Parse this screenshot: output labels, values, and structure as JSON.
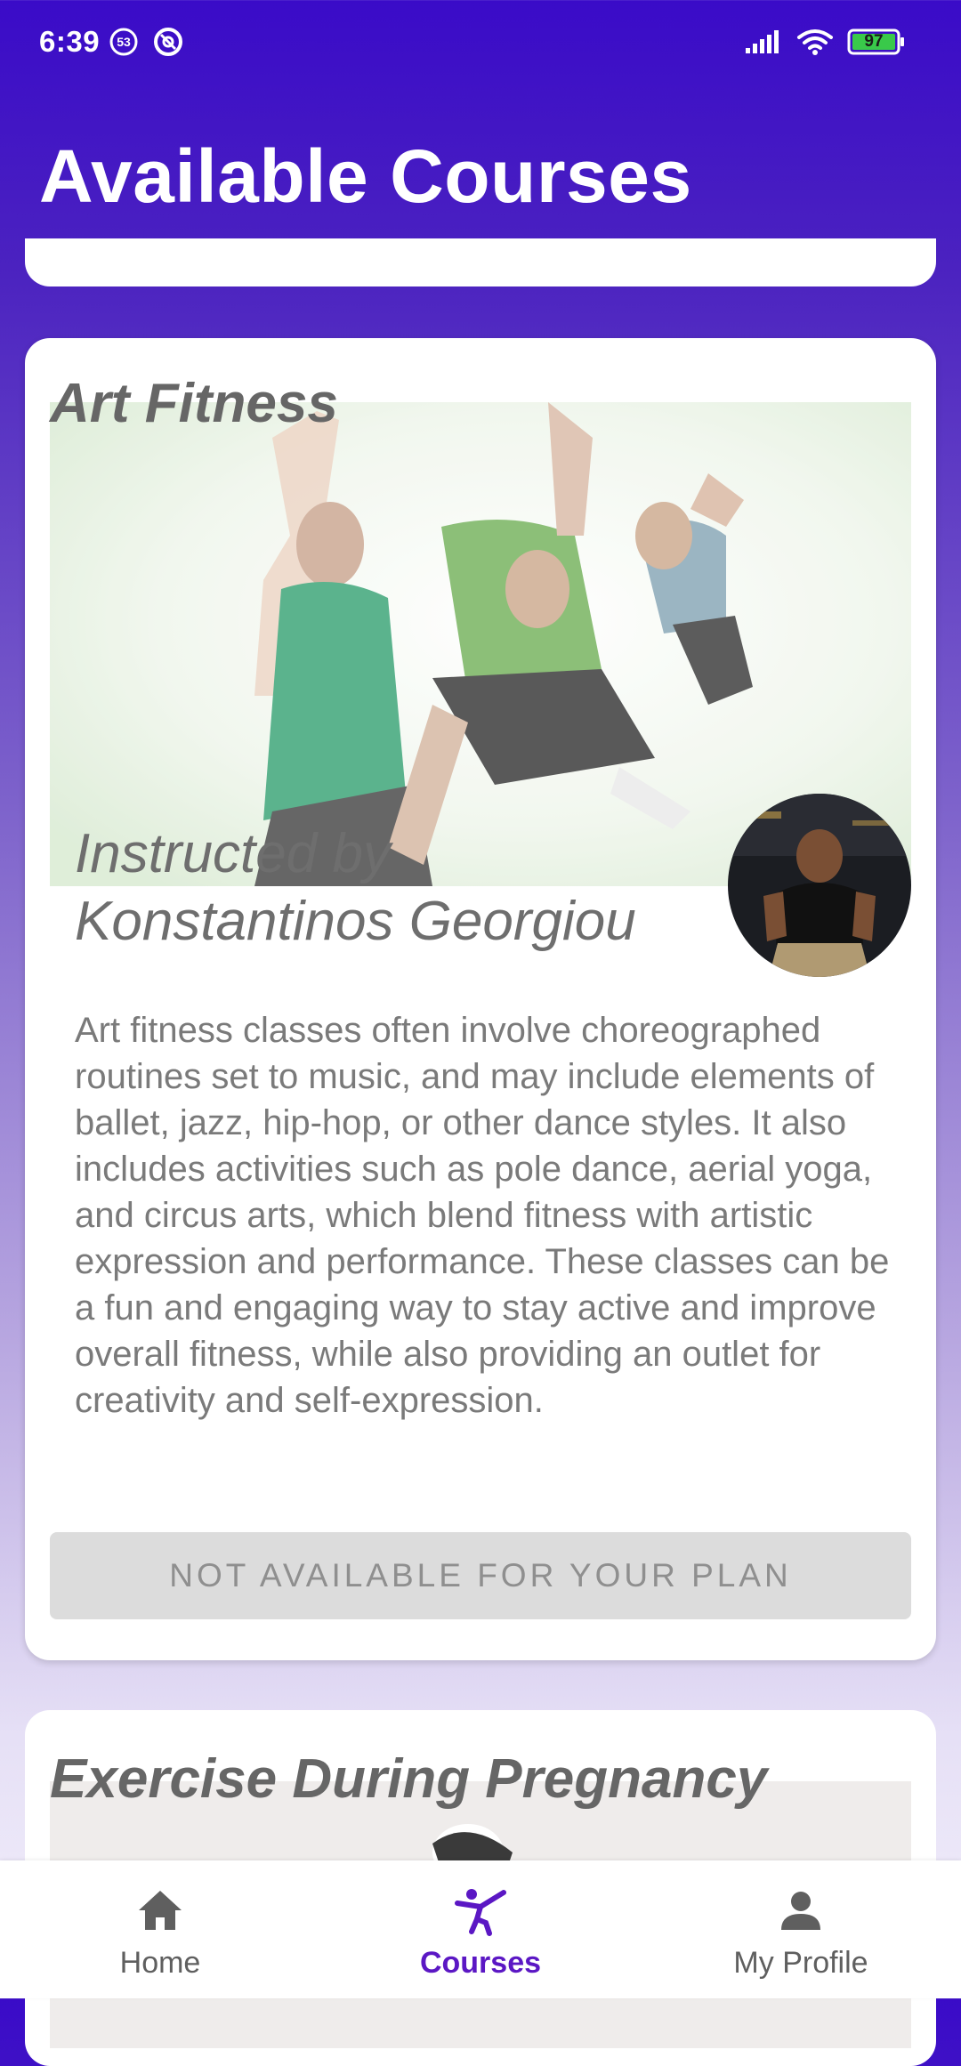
{
  "status_bar": {
    "time": "6:39",
    "notification_count": "53",
    "battery": "97"
  },
  "header": {
    "title": "Available Courses"
  },
  "courses": [
    {
      "title": "Art Fitness",
      "instructor_line1": "Instructed by",
      "instructor_line2": "Konstantinos Georgiou",
      "description": "Art fitness classes often involve choreographed routines set to music, and may include elements of ballet, jazz, hip-hop, or other dance styles. It also includes activities such as pole dance, aerial yoga, and circus arts, which blend fitness with artistic expression and performance. These classes can be a fun and engaging way to stay active and improve overall fitness, while also providing an outlet for creativity and self-expression.",
      "action_label": "NOT AVAILABLE FOR YOUR PLAN"
    },
    {
      "title": "Exercise During Pregnancy"
    }
  ],
  "bottom_nav": {
    "items": [
      {
        "label": "Home",
        "icon": "home-icon"
      },
      {
        "label": "Courses",
        "icon": "courses-icon",
        "active": true
      },
      {
        "label": "My Profile",
        "icon": "profile-icon"
      }
    ]
  },
  "colors": {
    "primary": "#5b17c4",
    "header_bg": "#3a0bc8",
    "disabled_button_bg": "#dcdcdc"
  }
}
